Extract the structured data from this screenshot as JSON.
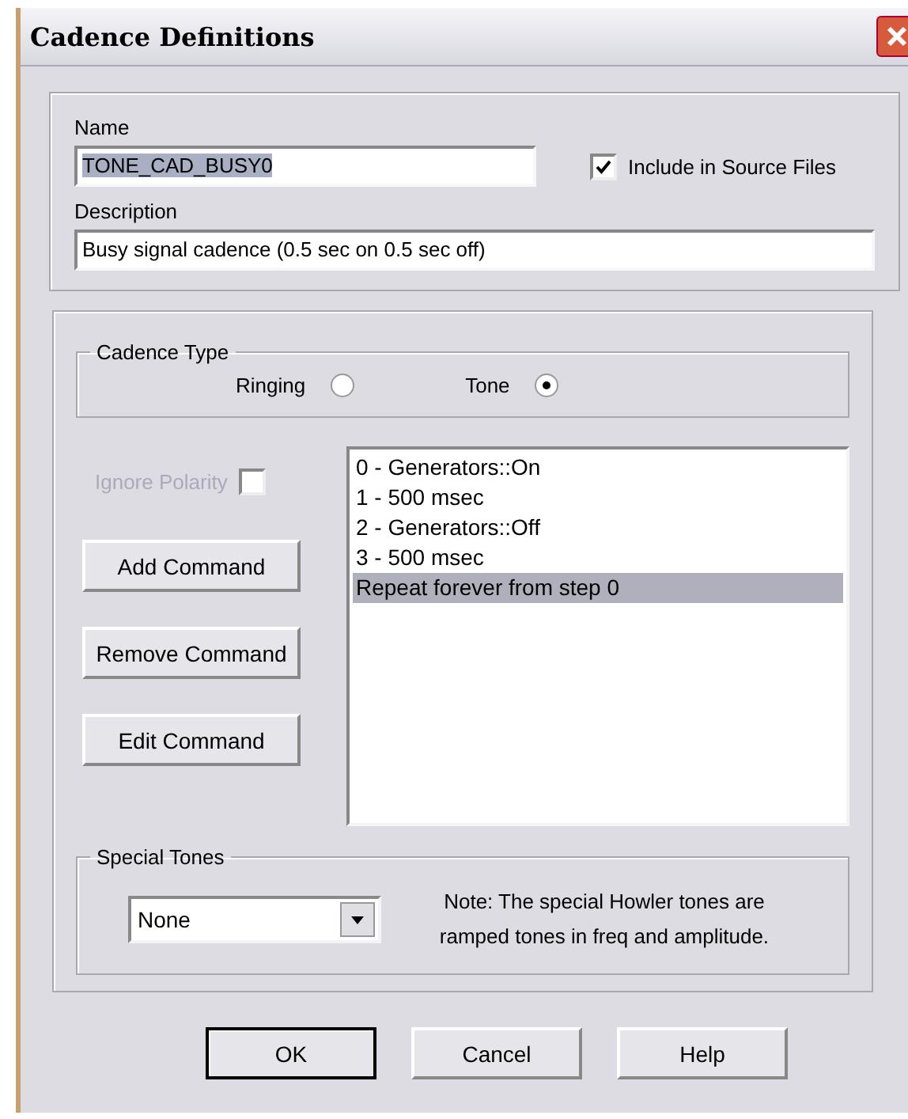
{
  "window": {
    "title": "Cadence Definitions"
  },
  "name": {
    "label": "Name",
    "value": "TONE_CAD_BUSY0",
    "highlighted": true
  },
  "include_in_source": {
    "label": "Include in Source Files",
    "checked": true
  },
  "description": {
    "label": "Description",
    "value": "Busy signal cadence (0.5 sec on 0.5 sec off)"
  },
  "cadence_type": {
    "title": "Cadence Type",
    "options": [
      {
        "label": "Ringing",
        "selected": false
      },
      {
        "label": "Tone",
        "selected": true
      }
    ]
  },
  "ignore_polarity": {
    "label": "Ignore Polarity",
    "checked": false,
    "disabled": true
  },
  "command_buttons": [
    "Add Command",
    "Remove Command",
    "Edit Command"
  ],
  "commands": [
    {
      "text": "0 - Generators::On",
      "selected": false
    },
    {
      "text": "1 - 500 msec",
      "selected": false
    },
    {
      "text": "2 - Generators::Off",
      "selected": false
    },
    {
      "text": "3 - 500 msec",
      "selected": false
    },
    {
      "text": "Repeat forever from step 0",
      "selected": true
    }
  ],
  "special_tones": {
    "title": "Special Tones",
    "value": "None",
    "note": "Note: The special Howler tones are ramped tones in freq and amplitude."
  },
  "buttons": [
    {
      "label": "OK",
      "default": true
    },
    {
      "label": "Cancel",
      "default": false
    },
    {
      "label": "Help",
      "default": false
    }
  ]
}
